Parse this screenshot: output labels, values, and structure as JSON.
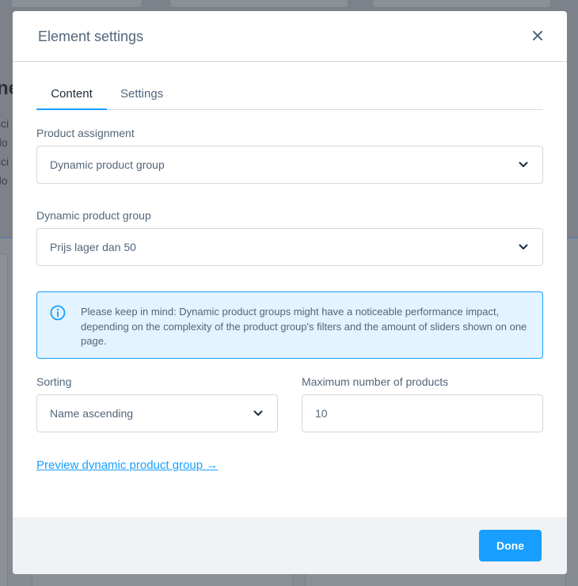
{
  "background": {
    "heading_fragment": "ne",
    "lines": [
      "sci",
      "do",
      "sci",
      "do"
    ]
  },
  "modal": {
    "title": "Element settings",
    "close_icon": "close-icon",
    "tabs": [
      {
        "label": "Content",
        "active": true
      },
      {
        "label": "Settings",
        "active": false
      }
    ],
    "product_assignment": {
      "label": "Product assignment",
      "value": "Dynamic product group"
    },
    "dynamic_product_group": {
      "label": "Dynamic product group",
      "value": "Prijs lager dan 50"
    },
    "info": {
      "icon": "info-icon",
      "text": "Please keep in mind: Dynamic product groups might have a noticeable performance impact, depending on the complexity of the product group's filters and the amount of sliders shown on one page."
    },
    "sorting": {
      "label": "Sorting",
      "value": "Name ascending"
    },
    "max_products": {
      "label": "Maximum number of products",
      "value": "10"
    },
    "preview_link": "Preview dynamic product group →",
    "done_label": "Done"
  },
  "colors": {
    "accent": "#189eff",
    "info_bg": "#e3f3ff",
    "text": "#52667a",
    "footer_bg": "#f0f2f5"
  }
}
